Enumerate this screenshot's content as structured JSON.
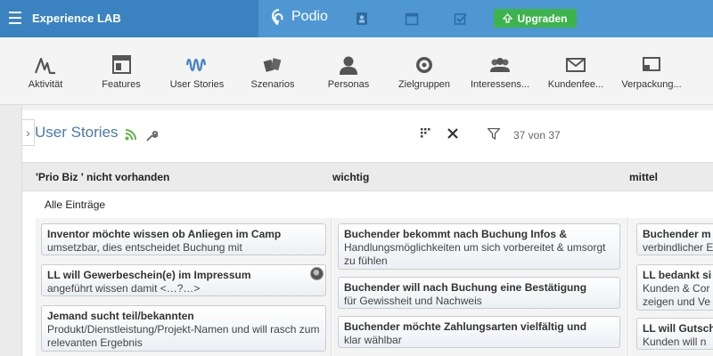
{
  "topbar": {
    "brand": "Experience LAB",
    "podio_label": "Podio",
    "upgrade_label": "Upgraden",
    "icons": [
      "contacts-icon",
      "calendar-icon",
      "tasks-icon"
    ]
  },
  "apps": [
    {
      "label": "Aktivität",
      "icon": "activity-icon"
    },
    {
      "label": "Features",
      "icon": "layout-icon"
    },
    {
      "label": "User Stories",
      "icon": "wave-icon"
    },
    {
      "label": "Szenarios",
      "icon": "cards-icon"
    },
    {
      "label": "Personas",
      "icon": "person-icon"
    },
    {
      "label": "Zielgruppen",
      "icon": "target-icon"
    },
    {
      "label": "Interessens...",
      "icon": "group-icon"
    },
    {
      "label": "Kundenfee...",
      "icon": "mail-icon"
    },
    {
      "label": "Verpackung...",
      "icon": "cast-icon"
    }
  ],
  "view": {
    "title": "User Stories",
    "count": "37 von 37",
    "handle": "›"
  },
  "columns": [
    {
      "header": "'Prio Biz ' nicht vorhanden"
    },
    {
      "header": "wichtig"
    },
    {
      "header": "mittel"
    }
  ],
  "group_label": "Alle Einträge",
  "cards": {
    "col1": [
      {
        "title": "Inventor möchte wissen ob Anliegen im Camp",
        "body": "umsetzbar, dies entscheidet Buchung mit"
      },
      {
        "title": "LL will Gewerbeschein(e) im Impressum",
        "body": "angeführt wissen damit <…?…>"
      },
      {
        "title": "Jemand sucht teil/bekannten",
        "body": "Produkt/Dienstleistung/Projekt-Namen und will rasch zum relevanten Ergebnis"
      }
    ],
    "col2": [
      {
        "title": "Buchender bekommt nach Buchung Infos &",
        "body": "Handlungsmöglichkeiten um sich vorbereitet & umsorgt zu fühlen"
      },
      {
        "title": "Buchender will nach Buchung eine Bestätigung",
        "body": "für Gewissheit und Nachweis"
      },
      {
        "title": "Buchender möchte Zahlungsarten vielfältig und",
        "body": "klar wählbar"
      }
    ],
    "col3": [
      {
        "title": "Buchender m",
        "body": "verbindlicher E"
      },
      {
        "title": "LL bedankt si",
        "body": "Kunden & Cor zeigen und Ve"
      },
      {
        "title": "LL will Gutsch",
        "body": "Kunden will n"
      }
    ]
  }
}
